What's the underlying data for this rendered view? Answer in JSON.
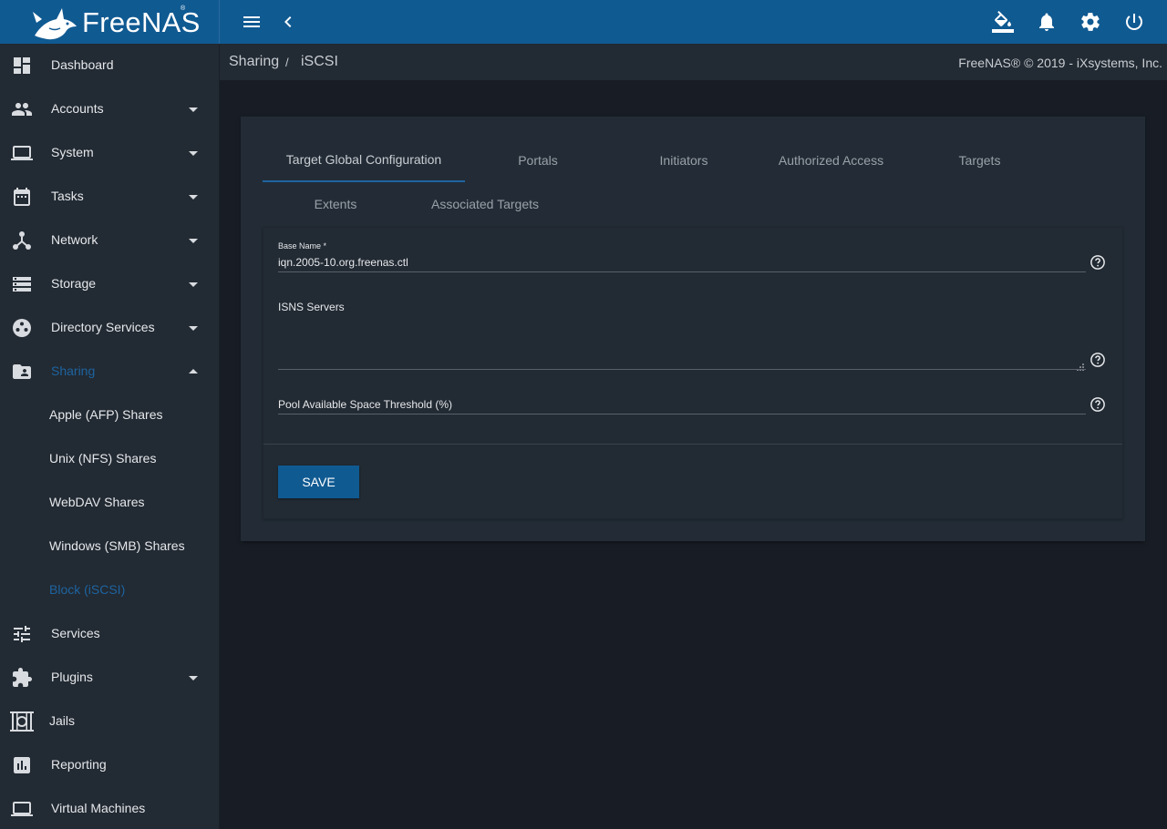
{
  "brand": {
    "name": "FreeNAS",
    "reg": "®"
  },
  "topbar": {
    "icons": [
      "menu-icon",
      "chevron-left-icon",
      "theme-paint-icon",
      "notifications-bell-icon",
      "settings-gear-icon",
      "power-icon"
    ]
  },
  "breadcrumb": {
    "parent": "Sharing",
    "separator": "/",
    "current": "iSCSI"
  },
  "copyright": "FreeNAS® © 2019 - iXsystems, Inc.",
  "sidebar": {
    "items": [
      {
        "label": "Dashboard",
        "icon": "dashboard-icon"
      },
      {
        "label": "Accounts",
        "icon": "accounts-people-icon"
      },
      {
        "label": "System",
        "icon": "system-laptop-icon"
      },
      {
        "label": "Tasks",
        "icon": "tasks-calendar-icon"
      },
      {
        "label": "Network",
        "icon": "network-icon"
      },
      {
        "label": "Storage",
        "icon": "storage-icon"
      },
      {
        "label": "Directory Services",
        "icon": "directory-services-icon"
      },
      {
        "label": "Sharing",
        "icon": "sharing-folder-icon"
      },
      {
        "label": "Services",
        "icon": "services-tune-icon"
      },
      {
        "label": "Plugins",
        "icon": "plugins-puzzle-icon"
      },
      {
        "label": "Jails",
        "icon": "jails-icon"
      },
      {
        "label": "Reporting",
        "icon": "reporting-chart-icon"
      },
      {
        "label": "Virtual Machines",
        "icon": "virtual-machines-icon"
      }
    ],
    "sharing_sub": [
      {
        "label": "Apple (AFP) Shares"
      },
      {
        "label": "Unix (NFS) Shares"
      },
      {
        "label": "WebDAV Shares"
      },
      {
        "label": "Windows (SMB) Shares"
      },
      {
        "label": "Block (iSCSI)"
      }
    ],
    "accent_color": "#1e64a0"
  },
  "tabs": [
    {
      "label": "Target Global Configuration"
    },
    {
      "label": "Portals"
    },
    {
      "label": "Initiators"
    },
    {
      "label": "Authorized Access"
    },
    {
      "label": "Targets"
    },
    {
      "label": "Extents"
    },
    {
      "label": "Associated Targets"
    }
  ],
  "form": {
    "base_name": {
      "label": "Base Name *",
      "value": "iqn.2005-10.org.freenas.ctl"
    },
    "isns_servers": {
      "label": "ISNS Servers",
      "value": ""
    },
    "pool_threshold": {
      "label": "Pool Available Space Threshold (%)",
      "value": ""
    },
    "save_label": "SAVE"
  },
  "colors": {
    "topbar": "#105a92",
    "sidebar": "#222a33",
    "background": "#181d25",
    "accent": "#1e64a0"
  }
}
